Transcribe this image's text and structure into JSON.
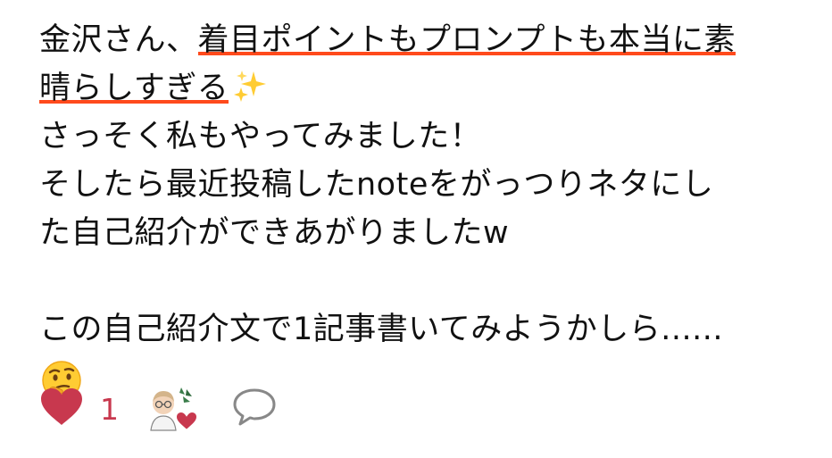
{
  "comment": {
    "line1_highlight": "着目ポイントもプロンプトも本当に素",
    "line1_prefix": "金沢さん、",
    "line2_highlight": "晴らしすぎる",
    "line3": "さっそく私もやってみました！",
    "line4": "そしたら最近投稿したnoteをがっつりネタにし",
    "line5": "た自己紹介ができあがりましたw",
    "line6": "この自己紹介文で1記事書いてみようかしら......",
    "emojis": {
      "sparkles": "sparkles-icon",
      "thinking": "thinking-face-icon"
    }
  },
  "actions": {
    "like_count": "1",
    "icons": {
      "like": "heart-icon",
      "liker": "liker-avatar",
      "comment": "speech-bubble-icon"
    }
  },
  "colors": {
    "highlight": "#ff4a1c",
    "heart": "#c8384e",
    "text": "#111111",
    "comment_icon": "#888888"
  }
}
